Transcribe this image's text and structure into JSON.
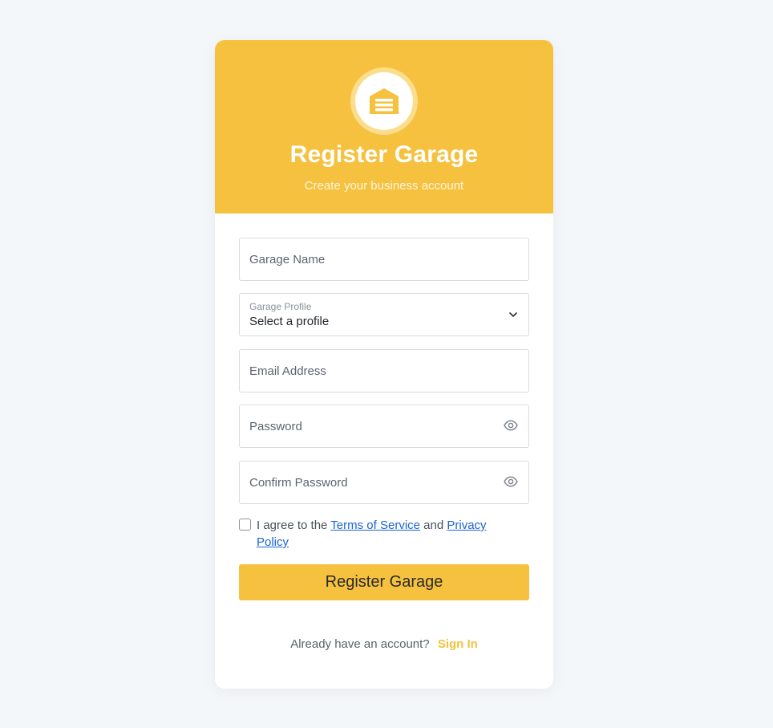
{
  "header": {
    "title": "Register Garage",
    "subtitle": "Create your business account",
    "logo_icon": "garage-icon"
  },
  "form": {
    "garage_name": {
      "placeholder": "Garage Name",
      "value": ""
    },
    "garage_profile": {
      "label": "Garage Profile",
      "selected": "Select a profile"
    },
    "email": {
      "placeholder": "Email Address",
      "value": ""
    },
    "password": {
      "placeholder": "Password",
      "value": "",
      "toggle_icon": "eye-icon"
    },
    "confirm_password": {
      "placeholder": "Confirm Password",
      "value": "",
      "toggle_icon": "eye-icon"
    },
    "agree": {
      "checked": false,
      "prefix": "I agree to the ",
      "terms_link": "Terms of Service",
      "middle": " and ",
      "privacy_link": "Privacy Policy"
    },
    "submit_label": "Register Garage"
  },
  "footer": {
    "prompt": "Already have an account?",
    "signin_link": "Sign In"
  },
  "colors": {
    "accent": "#f5c13f",
    "background": "#f4f7fa",
    "link": "#1a64d6"
  }
}
